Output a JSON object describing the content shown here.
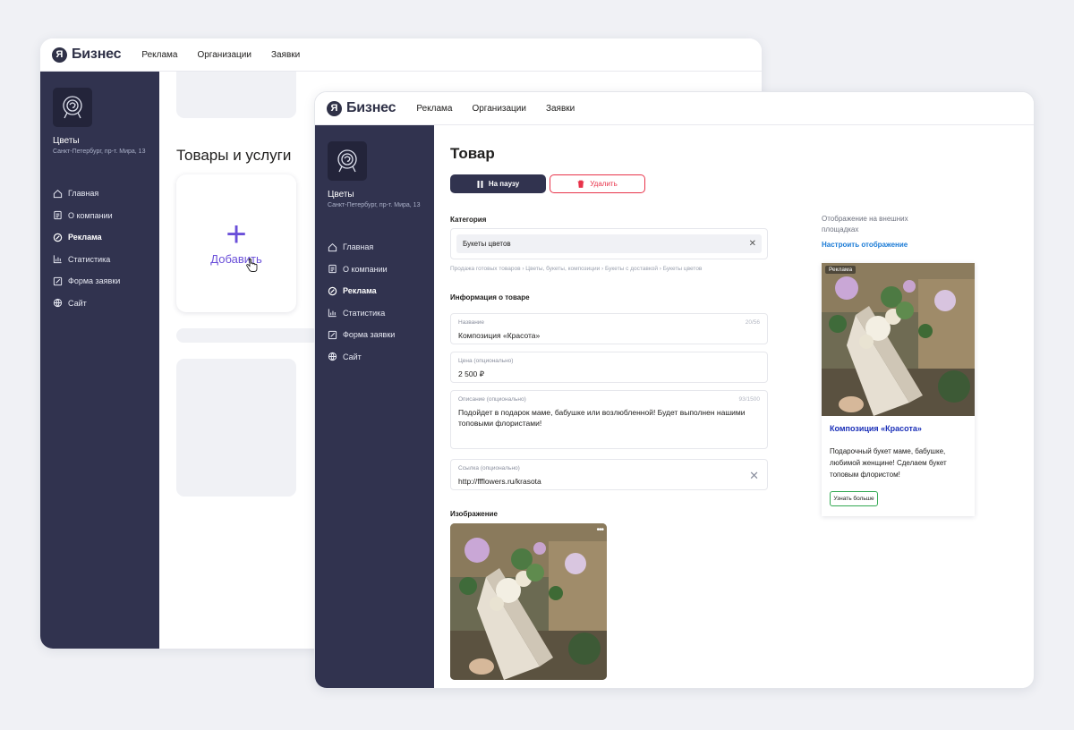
{
  "brand": {
    "mark": "Я",
    "name": "Бизнес"
  },
  "topnav": [
    "Реклама",
    "Организации",
    "Заявки"
  ],
  "org": {
    "name": "Цветы",
    "address": "Санкт-Петербург, пр-т. Мира, 13"
  },
  "sidebar": {
    "items": [
      {
        "label": "Главная",
        "icon": "home-icon",
        "active": false
      },
      {
        "label": "О компании",
        "icon": "document-icon",
        "active": false
      },
      {
        "label": "Реклама",
        "icon": "rocket-icon",
        "active": true
      },
      {
        "label": "Статистика",
        "icon": "chart-icon",
        "active": false
      },
      {
        "label": "Форма заявки",
        "icon": "edit-icon",
        "active": false
      },
      {
        "label": "Сайт",
        "icon": "globe-icon",
        "active": false
      }
    ]
  },
  "back": {
    "title": "Товары и услуги",
    "add_plus": "+",
    "add_label": "Добавить"
  },
  "product": {
    "title": "Товар",
    "pause_label": "На паузу",
    "delete_label": "Удалить",
    "category_label": "Категория",
    "category_value": "Букеты цветов",
    "breadcrumbs": "Продажа готовых товаров  ›  Цветы, букеты, композиции  ›  Букеты с доставкой  ›  Букеты цветов",
    "info_label": "Информация о товаре",
    "name": {
      "label": "Название",
      "value": "Композиция «Красота»",
      "count": "20/56"
    },
    "price": {
      "label": "Цена (опционально)",
      "value": "2 500 ₽"
    },
    "description": {
      "label": "Описание (опционально)",
      "value": "Подойдет в подарок маме, бабушке или возлюбленной! Будет выполнен нашими топовыми флористами!",
      "count": "93/1500"
    },
    "link": {
      "label": "Ссылка (опционально)",
      "value": "http://ffflowers.ru/krasota"
    },
    "image_label": "Изображение",
    "image_menu": "•••"
  },
  "preview": {
    "label": "Отображение на внешних площадках",
    "link": "Настроить отображение",
    "badge": "Реклама",
    "title": "Композиция «Красота»",
    "text": "Подарочный букет маме, бабушке, любимой женщине! Сделаем букет топовым флористом!",
    "button": "Узнать больше"
  },
  "colors": {
    "sidebar": "#31334f",
    "accent": "#6a4fd9",
    "danger": "#e8334a",
    "link": "#1b7bd6",
    "ad_title": "#1a2fb8",
    "ad_button_border": "#32a852"
  }
}
